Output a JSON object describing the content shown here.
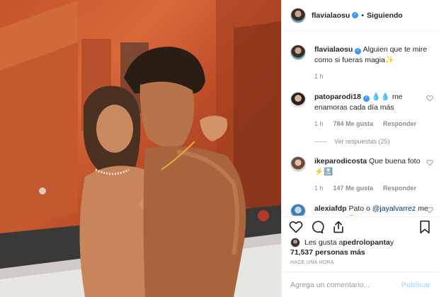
{
  "post": {
    "author": "flavialaosu",
    "follow_state": "Siguiendo",
    "separator": "•",
    "caption": "Alguien que te mire como si fueras magia✨",
    "caption_time": "1 h"
  },
  "comments": [
    {
      "user": "patoparodi18",
      "text": "💧💧 me enamoras cada día más",
      "time": "1 h",
      "likes": "784 Me gusta",
      "reply": "Responder",
      "view_replies": "Ver respuestas (25)"
    },
    {
      "user": "ikeparodicosta",
      "text": "Que buena foto ⚡🔝",
      "time": "1 h",
      "likes": "147 Me gusta",
      "reply": "Responder"
    },
    {
      "user": "alexiafdp",
      "text_pre": "Pato o ",
      "mention": "@jayalvarrez",
      "text_post": " me confundo 😔"
    }
  ],
  "likes": {
    "prefix": "Les gusta a ",
    "user": "pedrolopanta",
    "conj": " y",
    "count": "71,537 personas más",
    "time": "HACE UNA HORA"
  },
  "comment_box": {
    "placeholder": "Agrega un comentario...",
    "publish": "Publicar"
  },
  "icons": [
    "verified-icon",
    "heart-icon",
    "comment-icon",
    "share-icon",
    "bookmark-icon"
  ],
  "colors": {
    "link": "#003569",
    "verified": "#3897f0",
    "muted": "#8e8e8e",
    "publish_disabled": "#b2dffc"
  }
}
